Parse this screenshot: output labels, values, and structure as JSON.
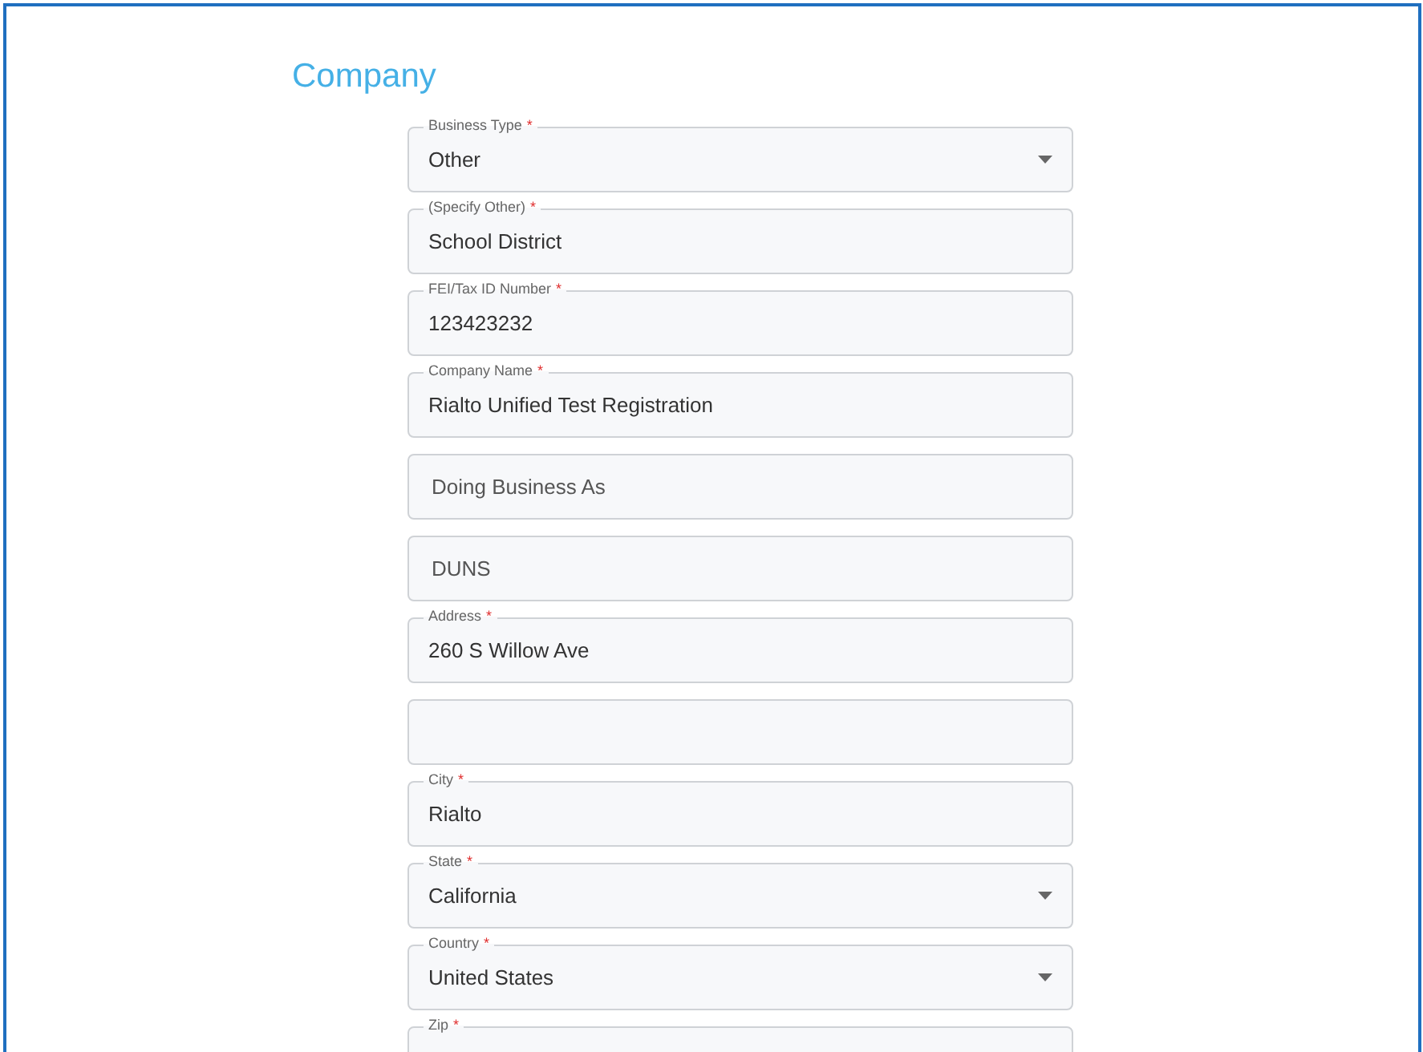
{
  "section_title": "Company",
  "fields": [
    {
      "kind": "select",
      "label": "Business Type",
      "required_mark": "*",
      "value": "Other"
    },
    {
      "kind": "text",
      "label": "(Specify Other)",
      "required_mark": "*",
      "value": "School District"
    },
    {
      "kind": "text",
      "label": "FEI/Tax ID Number",
      "required_mark": "*",
      "value": "123423232"
    },
    {
      "kind": "text",
      "label": "Company Name",
      "required_mark": "*",
      "value": "Rialto Unified Test Registration"
    },
    {
      "kind": "text",
      "placeholder": "Doing Business As"
    },
    {
      "kind": "text",
      "placeholder": "DUNS"
    },
    {
      "kind": "text",
      "label": "Address",
      "required_mark": "*",
      "value": "260 S Willow Ave"
    },
    {
      "kind": "text"
    },
    {
      "kind": "text",
      "label": "City",
      "required_mark": "*",
      "value": "Rialto"
    },
    {
      "kind": "select",
      "label": "State",
      "required_mark": "*",
      "value": "California"
    },
    {
      "kind": "select",
      "label": "Country",
      "required_mark": "*",
      "value": "United States"
    },
    {
      "kind": "text",
      "label": "Zip",
      "required_mark": "*"
    }
  ]
}
